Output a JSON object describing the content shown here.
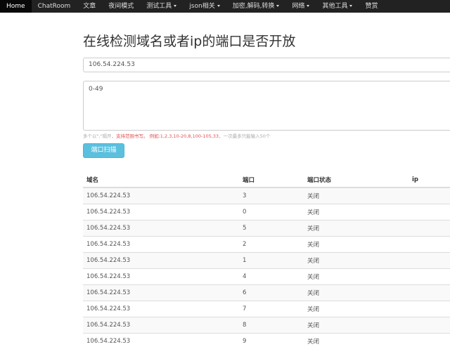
{
  "nav": {
    "items": [
      {
        "label": "Home",
        "active": true,
        "dropdown": false
      },
      {
        "label": "ChatRoom",
        "active": false,
        "dropdown": false
      },
      {
        "label": "文章",
        "active": false,
        "dropdown": false
      },
      {
        "label": "夜间模式",
        "active": false,
        "dropdown": false
      },
      {
        "label": "测试工具",
        "active": false,
        "dropdown": true
      },
      {
        "label": "json相关",
        "active": false,
        "dropdown": true
      },
      {
        "label": "加密,解码,转换",
        "active": false,
        "dropdown": true
      },
      {
        "label": "网络",
        "active": false,
        "dropdown": true
      },
      {
        "label": "其他工具",
        "active": false,
        "dropdown": true
      },
      {
        "label": "赞赏",
        "active": false,
        "dropdown": false
      }
    ]
  },
  "page": {
    "title": "在线检测域名或者ip的端口是否开放"
  },
  "form": {
    "host_value": "106.54.224.53",
    "ports_value": "0-49",
    "help_prefix": "多个以\",\"隔开，",
    "help_highlight": "支持范围书写。 例如:1,2,3,10-20,8,100-105,33",
    "help_suffix": "，一次最多只能输入50个",
    "scan_label": "端口扫描"
  },
  "table": {
    "headers": [
      "域名",
      "端口",
      "端口状态",
      "ip"
    ],
    "rows": [
      {
        "domain": "106.54.224.53",
        "port": "3",
        "status": "关闭",
        "ip": ""
      },
      {
        "domain": "106.54.224.53",
        "port": "0",
        "status": "关闭",
        "ip": ""
      },
      {
        "domain": "106.54.224.53",
        "port": "5",
        "status": "关闭",
        "ip": ""
      },
      {
        "domain": "106.54.224.53",
        "port": "2",
        "status": "关闭",
        "ip": ""
      },
      {
        "domain": "106.54.224.53",
        "port": "1",
        "status": "关闭",
        "ip": ""
      },
      {
        "domain": "106.54.224.53",
        "port": "4",
        "status": "关闭",
        "ip": ""
      },
      {
        "domain": "106.54.224.53",
        "port": "6",
        "status": "关闭",
        "ip": ""
      },
      {
        "domain": "106.54.224.53",
        "port": "7",
        "status": "关闭",
        "ip": ""
      },
      {
        "domain": "106.54.224.53",
        "port": "8",
        "status": "关闭",
        "ip": ""
      },
      {
        "domain": "106.54.224.53",
        "port": "9",
        "status": "关闭",
        "ip": ""
      }
    ]
  },
  "colors": {
    "navbar_bg": "#222222",
    "button_bg": "#5bc0de",
    "help_highlight": "#e05050"
  }
}
